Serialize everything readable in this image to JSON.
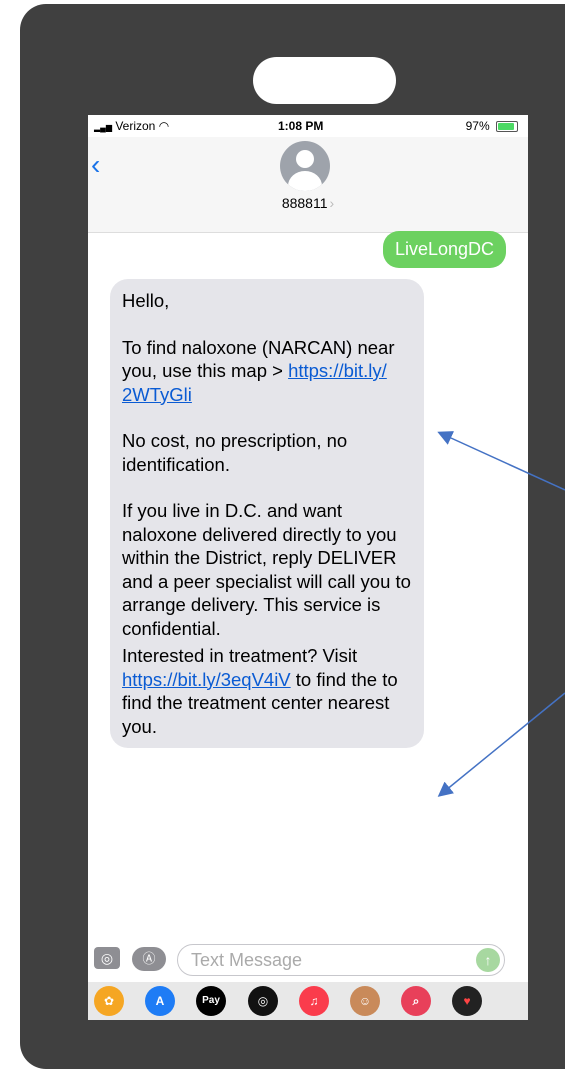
{
  "status_bar": {
    "carrier": "Verizon",
    "time": "1:08 PM",
    "battery": "97%",
    "battery_level": 0.97
  },
  "header": {
    "contact": "888811",
    "back_icon": "chevron-left-icon",
    "contact_chevron": "›"
  },
  "messages": {
    "sent": "LiveLongDC",
    "received": {
      "greeting": "Hello,",
      "p1_text": "To find naloxone (NARCAN) near you, use this map > ",
      "p1_link_a": "https://bit.ly/",
      "p1_link_b": "2WTyGli",
      "p2": "No cost, no prescription, no identification.",
      "p3": "If you live in D.C. and want naloxone delivered directly to you within the District, reply DELIVER and a peer specialist will call you to arrange delivery. This service is confidential.",
      "p4_text_a": "Interested in treatment? Visit ",
      "p4_link": "https://bit.ly/3eqV4iV",
      "p4_text_b": " to find the to find the treatment center nearest you."
    }
  },
  "input_bar": {
    "placeholder": "Text Message",
    "camera_icon": "camera-icon",
    "appstore_icon": "appstore-icon",
    "send_icon": "send-arrow-icon"
  },
  "dock": {
    "apps": [
      "photos",
      "app-store",
      "apple-pay",
      "activity",
      "music",
      "memoji",
      "search",
      "heart"
    ],
    "apple_pay_label": "Pay"
  },
  "colors": {
    "frame": "#404040",
    "sent_bubble": "#6cd160",
    "received_bubble": "#e5e5ea",
    "link": "#0a5bd3",
    "annotation_arrow": "#4472c4"
  }
}
